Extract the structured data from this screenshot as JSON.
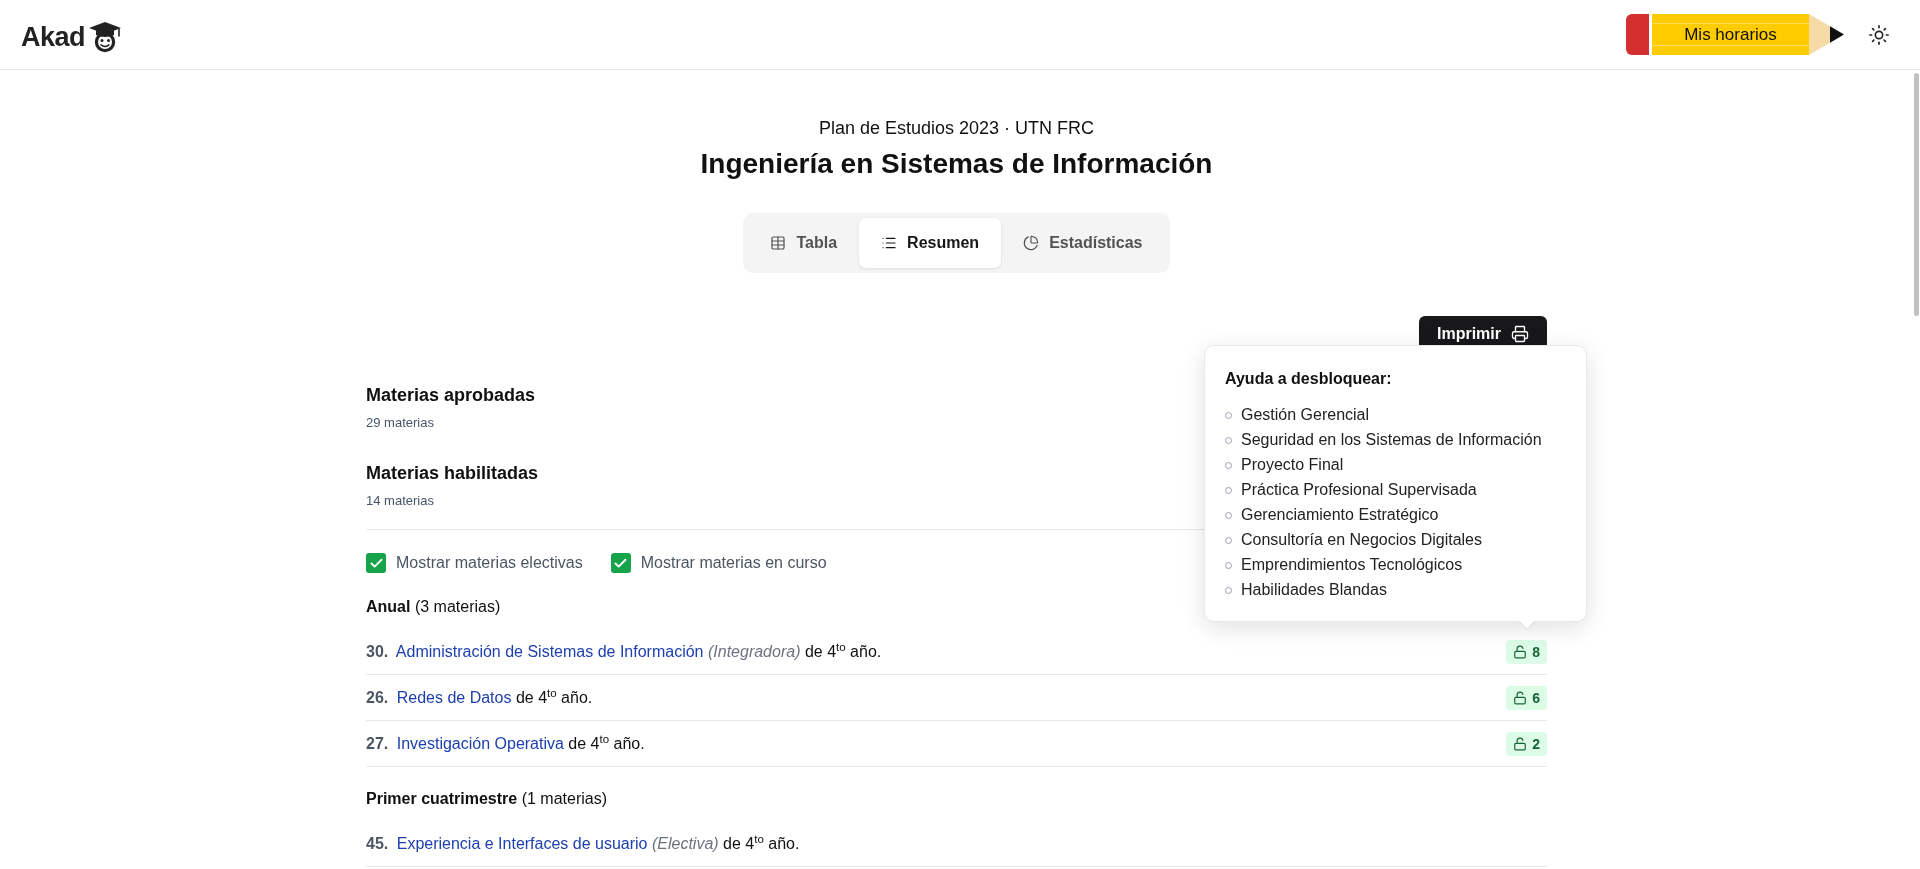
{
  "header": {
    "logo": "Akad",
    "schedule_button": "Mis horarios"
  },
  "plan": {
    "subtitle": "Plan de Estudios 2023 · UTN FRC",
    "title": "Ingeniería en Sistemas de Información"
  },
  "tabs": [
    {
      "label": "Tabla",
      "selected": false
    },
    {
      "label": "Resumen",
      "selected": true
    },
    {
      "label": "Estadísticas",
      "selected": false
    }
  ],
  "print_button": "Imprimir",
  "summary": [
    {
      "title": "Materias aprobadas",
      "count": "29 materias"
    },
    {
      "title": "Materias habilitadas",
      "count": "14 materias"
    }
  ],
  "filters": [
    {
      "label": "Mostrar materias electivas",
      "checked": true
    },
    {
      "label": "Mostrar materias en curso",
      "checked": true
    }
  ],
  "groups": [
    {
      "heading": "**Anual** (3 materias)",
      "rows": [
        {
          "number": "30.",
          "subject": "Administración de Sistemas de Información",
          "note": "(Integradora)",
          "detail": "de 4$^{to}$ año.",
          "unlocks": "8",
          "unlocks_tooltip": {
            "title": "Ayuda a desbloquear:",
            "items": [
              "Gestión Gerencial",
              "Seguridad en los Sistemas de Información",
              "Proyecto Final",
              "Práctica Profesional Supervisada",
              "Gerenciamiento Estratégico",
              "Consultoría en Negocios Digitales",
              "Emprendimientos Tecnológicos",
              "Habilidades Blandas"
            ]
          }
        },
        {
          "number": "26.",
          "subject": "Redes de Datos",
          "detail": "de 4$^{to}$ año.",
          "unlocks": "6"
        },
        {
          "number": "27.",
          "subject": "Investigación Operativa",
          "detail": "de 4$^{to}$ año.",
          "unlocks": "2"
        }
      ]
    },
    {
      "heading": "**Primer cuatrimestre** (1 materias)",
      "rows": [
        {
          "number": "45.",
          "subject": "Experiencia e Interfaces de usuario",
          "note": "(Electiva)",
          "detail": "de 4$^{to}$ año."
        }
      ]
    }
  ]
}
